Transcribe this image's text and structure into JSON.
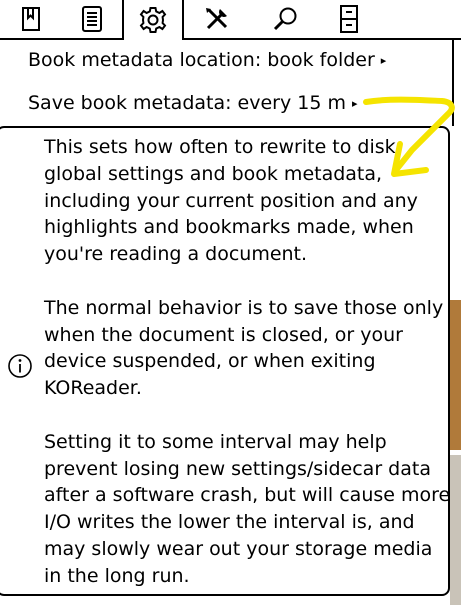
{
  "tabs": [
    {
      "name": "book-icon",
      "active": false
    },
    {
      "name": "document-list-icon",
      "active": false
    },
    {
      "name": "gear-icon",
      "active": true
    },
    {
      "name": "tools-icon",
      "active": false
    },
    {
      "name": "search-icon",
      "active": false
    },
    {
      "name": "cabinet-icon",
      "active": false
    }
  ],
  "menu": {
    "item_location": "Book metadata location: book folder",
    "item_save": "Save book metadata: every 15 m",
    "submenu_arrow": "▸"
  },
  "popup": {
    "paragraph_1": "This sets how often to rewrite to disk global settings and book metadata, including your current position and any highlights and bookmarks made, when you're reading a document.",
    "paragraph_2": "The normal behavior is to save those only when the document is closed, or your device suspended, or when exiting KOReader.",
    "paragraph_3": "Setting it to some interval may help prevent losing new settings/sidecar data after a software crash, but will cause more I/O writes the lower the interval is, and may slowly wear out your storage media in the long run.",
    "icon": "info-icon"
  },
  "annotation": {
    "color": "#f5e400",
    "shape": "hand-drawn-arrow"
  }
}
